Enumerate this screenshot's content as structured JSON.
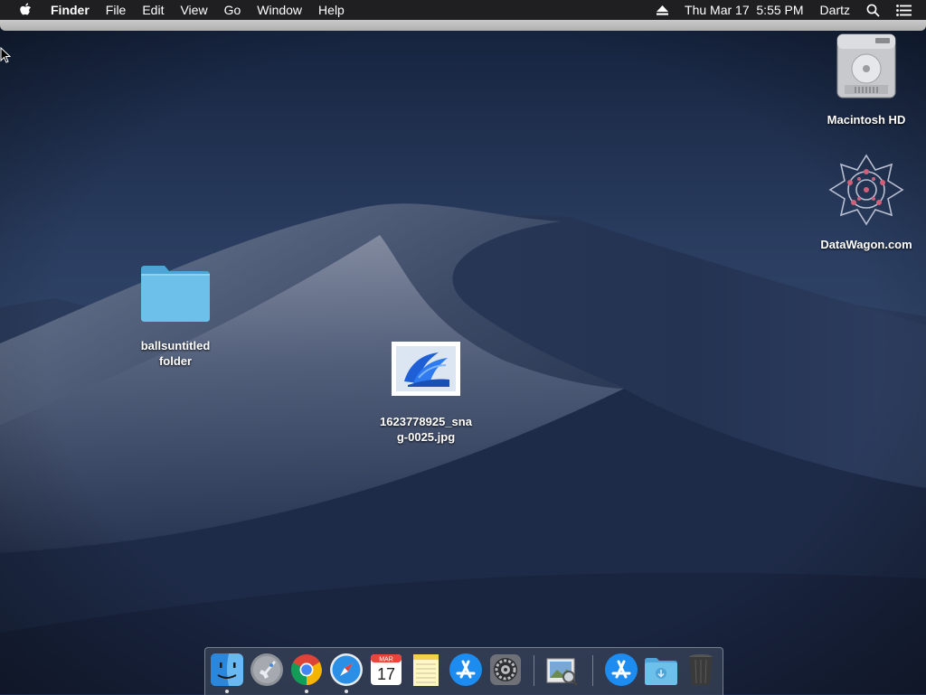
{
  "menubar": {
    "apple_icon": "apple-logo-icon",
    "app_name": "Finder",
    "menus": [
      "File",
      "Edit",
      "View",
      "Go",
      "Window",
      "Help"
    ],
    "eject_icon": "eject-icon",
    "clock": "Thu Mar 17  5:55 PM",
    "user": "Dartz",
    "spotlight_icon": "spotlight-search-icon",
    "notification_icon": "notification-center-icon"
  },
  "desktop": {
    "icons": [
      {
        "label": "Macintosh HD",
        "icon": "hard-drive-icon"
      },
      {
        "label": "DataWagon.com",
        "icon": "datawagon-logo-icon"
      },
      {
        "label": "ballsuntitled folder",
        "label_line1": "ballsuntitled",
        "label_line2": "folder",
        "icon": "folder-icon"
      },
      {
        "label": "1623778925_snag-0025.jpg",
        "label_line1": "1623778925_sna",
        "label_line2": "g-0025.jpg",
        "icon": "image-file-icon"
      }
    ]
  },
  "dock": {
    "items": [
      {
        "name": "Finder",
        "icon": "finder-icon",
        "running": true
      },
      {
        "name": "Launchpad",
        "icon": "launchpad-icon",
        "running": false
      },
      {
        "name": "Google Chrome",
        "icon": "chrome-icon",
        "running": true
      },
      {
        "name": "Safari",
        "icon": "safari-icon",
        "running": true
      },
      {
        "name": "Calendar",
        "icon": "calendar-icon",
        "running": false,
        "month": "MAR",
        "day": "17"
      },
      {
        "name": "Notes",
        "icon": "notes-icon",
        "running": false
      },
      {
        "name": "App Store",
        "icon": "app-store-icon",
        "running": false
      },
      {
        "name": "System Preferences",
        "icon": "system-preferences-icon",
        "running": false
      },
      {
        "name": "Preview",
        "icon": "preview-icon",
        "running": false
      },
      {
        "name": "App Store",
        "icon": "app-store-icon",
        "running": false
      },
      {
        "name": "Downloads",
        "icon": "downloads-folder-icon",
        "running": false
      },
      {
        "name": "Trash",
        "icon": "trash-icon",
        "running": false
      }
    ]
  },
  "colors": {
    "menubar_bg": "#1f1f21",
    "folder_blue": "#5fb6e3",
    "sky_dark": "#1b2a4a"
  }
}
